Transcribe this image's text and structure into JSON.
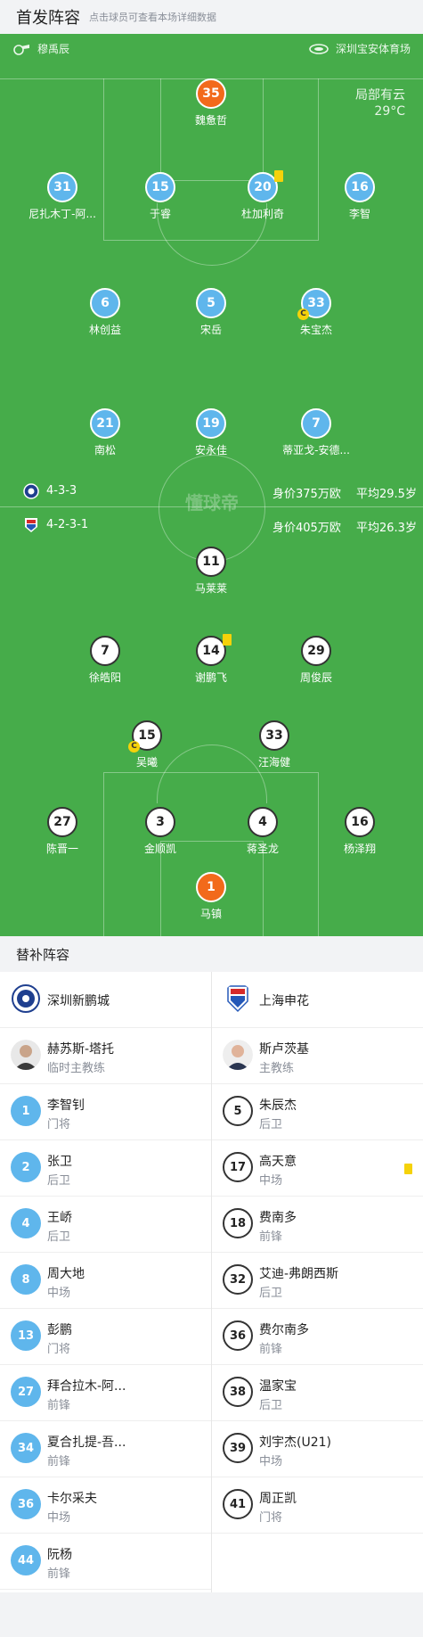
{
  "header": {
    "title": "首发阵容",
    "hint": "点击球员可查看本场详细数据"
  },
  "match": {
    "referee": "穆禹辰",
    "venue": "深圳宝安体育场",
    "weather": "局部有云",
    "temperature": "29°C",
    "watermark": "懂球帝"
  },
  "home_team": {
    "formation": "4-3-3",
    "value": "身价375万欧",
    "avg_age": "平均29.5岁",
    "color": "#5fb6ec"
  },
  "away_team": {
    "formation": "4-2-3-1",
    "value": "身价405万欧",
    "avg_age": "平均26.3岁"
  },
  "home_players": [
    {
      "num": "35",
      "name": "魏惫哲"
    },
    {
      "num": "31",
      "name": "尼扎木丁-阿..."
    },
    {
      "num": "15",
      "name": "于睿"
    },
    {
      "num": "20",
      "name": "杜加利奇",
      "card": "yellow"
    },
    {
      "num": "16",
      "name": "李智"
    },
    {
      "num": "6",
      "name": "林创益"
    },
    {
      "num": "5",
      "name": "宋岳"
    },
    {
      "num": "33",
      "name": "朱宝杰",
      "captain": "C"
    },
    {
      "num": "21",
      "name": "南松"
    },
    {
      "num": "19",
      "name": "安永佳"
    },
    {
      "num": "7",
      "name": "蒂亚戈-安德..."
    }
  ],
  "away_players": [
    {
      "num": "11",
      "name": "马莱莱"
    },
    {
      "num": "7",
      "name": "徐皓阳"
    },
    {
      "num": "14",
      "name": "谢鹏飞",
      "card": "yellow"
    },
    {
      "num": "29",
      "name": "周俊辰"
    },
    {
      "num": "15",
      "name": "吴曦",
      "captain": "C"
    },
    {
      "num": "33",
      "name": "汪海健"
    },
    {
      "num": "27",
      "name": "陈晋一"
    },
    {
      "num": "3",
      "name": "金顺凯"
    },
    {
      "num": "4",
      "name": "蒋圣龙"
    },
    {
      "num": "16",
      "name": "杨泽翔"
    },
    {
      "num": "1",
      "name": "马镇"
    }
  ],
  "subs": {
    "title": "替补阵容",
    "left_team": "深圳新鹏城",
    "right_team": "上海申花",
    "left_coach": {
      "name": "赫苏斯-塔托",
      "role": "临时主教练"
    },
    "right_coach": {
      "name": "斯卢茨基",
      "role": "主教练"
    },
    "left": [
      {
        "num": "1",
        "name": "李智钊",
        "pos": "门将"
      },
      {
        "num": "2",
        "name": "张卫",
        "pos": "后卫"
      },
      {
        "num": "4",
        "name": "王峤",
        "pos": "后卫"
      },
      {
        "num": "8",
        "name": "周大地",
        "pos": "中场"
      },
      {
        "num": "13",
        "name": "彭鹏",
        "pos": "门将"
      },
      {
        "num": "27",
        "name": "拜合拉木-阿...",
        "pos": "前锋"
      },
      {
        "num": "34",
        "name": "夏合扎提-吾...",
        "pos": "前锋"
      },
      {
        "num": "36",
        "name": "卡尔采夫",
        "pos": "中场"
      },
      {
        "num": "44",
        "name": "阮杨",
        "pos": "前锋"
      }
    ],
    "right": [
      {
        "num": "5",
        "name": "朱辰杰",
        "pos": "后卫"
      },
      {
        "num": "17",
        "name": "高天意",
        "pos": "中场",
        "card": "yellow"
      },
      {
        "num": "18",
        "name": "费南多",
        "pos": "前锋"
      },
      {
        "num": "32",
        "name": "艾迪-弗朗西斯",
        "pos": "后卫"
      },
      {
        "num": "36",
        "name": "费尔南多",
        "pos": "前锋"
      },
      {
        "num": "38",
        "name": "温家宝",
        "pos": "后卫"
      },
      {
        "num": "39",
        "name": "刘宇杰(U21)",
        "pos": "中场"
      },
      {
        "num": "41",
        "name": "周正凯",
        "pos": "门将"
      }
    ]
  }
}
